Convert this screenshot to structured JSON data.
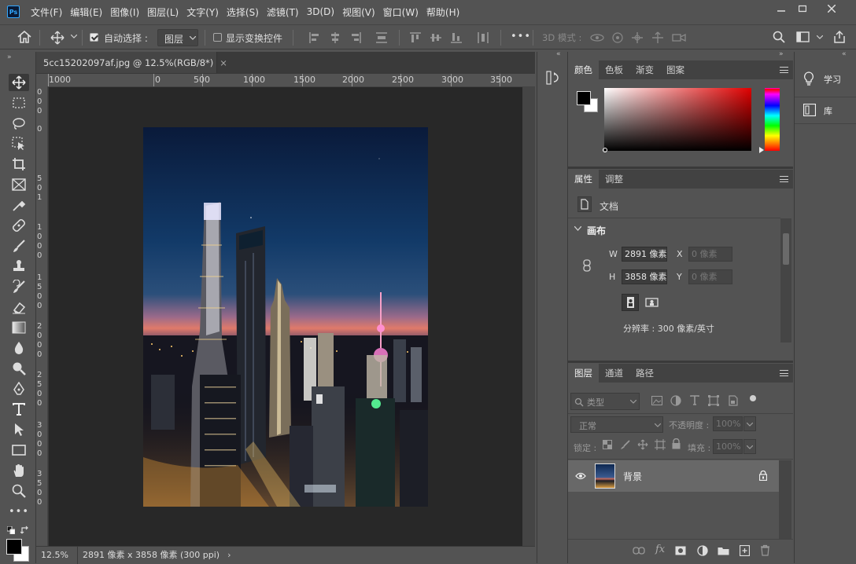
{
  "app": {
    "logo": "Ps"
  },
  "menu": [
    "文件(F)",
    "编辑(E)",
    "图像(I)",
    "图层(L)",
    "文字(Y)",
    "选择(S)",
    "滤镜(T)",
    "3D(D)",
    "视图(V)",
    "窗口(W)",
    "帮助(H)"
  ],
  "options": {
    "auto_select_label": "自动选择 :",
    "auto_select_value": "图层",
    "show_transform_label": "显示变换控件",
    "more": "•••",
    "mode_3d": "3D 模式 :"
  },
  "document": {
    "tab_title": "5cc15202097af.jpg @ 12.5%(RGB/8*)",
    "close": "×",
    "ruler_h_labels": [
      "1000",
      "0",
      "500",
      "1000",
      "1500",
      "2000",
      "2500",
      "3000",
      "3500"
    ],
    "ruler_v_labels": [
      "0",
      "0",
      "0",
      "5",
      "0",
      "0",
      "1",
      "0",
      "0",
      "0",
      "1",
      "5",
      "0",
      "0",
      "2",
      "0",
      "0",
      "0",
      "2",
      "5",
      "0",
      "0",
      "3",
      "0",
      "0",
      "0",
      "3",
      "5",
      "0",
      "0"
    ]
  },
  "status": {
    "zoom": "12.5%",
    "info": "2891 像素 x 3858 像素 (300 ppi)",
    "arrow": "›"
  },
  "color_panel": {
    "tabs": [
      "颜色",
      "色板",
      "渐变",
      "图案"
    ]
  },
  "properties_panel": {
    "tabs": [
      "属性",
      "调整"
    ],
    "doc_label": "文档",
    "section": "画布",
    "w_label": "W",
    "h_label": "H",
    "x_label": "X",
    "y_label": "Y",
    "w_value": "2891 像素",
    "h_value": "3858 像素",
    "x_placeholder": "0 像素",
    "y_placeholder": "0 像素",
    "resolution": "分辨率 : 300 像素/英寸"
  },
  "layers_panel": {
    "tabs": [
      "图层",
      "通道",
      "路径"
    ],
    "filter_placeholder": "类型",
    "blend_mode": "正常",
    "opacity_label": "不透明度 :",
    "opacity_value": "100%",
    "lock_label": "锁定 :",
    "fill_label": "填充 :",
    "fill_value": "100%",
    "layers": [
      {
        "name": "背景",
        "locked": true,
        "visible": true
      }
    ]
  },
  "far_panel": {
    "learn": "学习",
    "library": "库"
  },
  "colors": {
    "ui_bg": "#535353",
    "canvas_bg": "#282828",
    "accent": "#31a8ff"
  }
}
